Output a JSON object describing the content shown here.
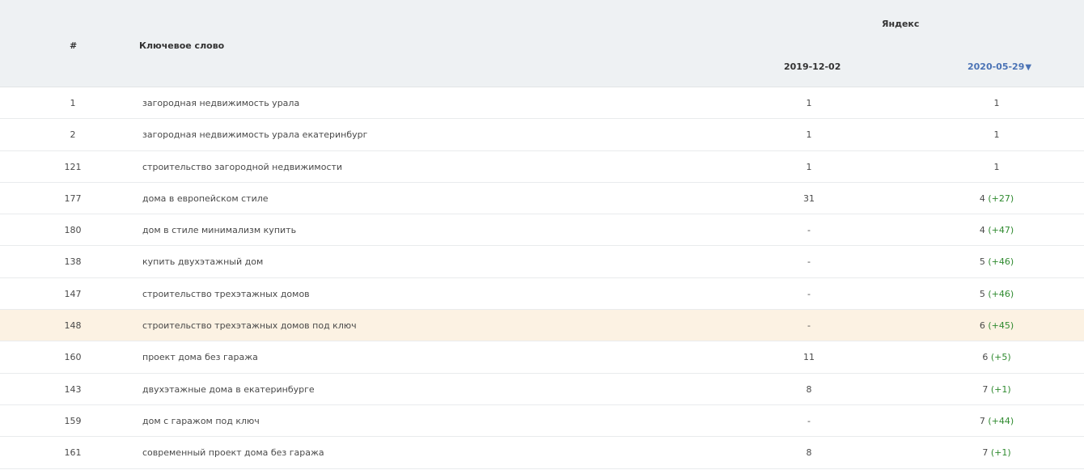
{
  "header": {
    "num": "#",
    "keyword": "Ключевое слово",
    "engine": "Яндекс",
    "date1": "2019-12-02",
    "date2": "2020-05-29",
    "sort_arrow": "▼"
  },
  "colors": {
    "header_bg": "#eef1f3",
    "highlight_bg": "#fcf2e3",
    "link": "#4b73b5",
    "positive_delta": "#2f8a2f"
  },
  "rows": [
    {
      "num": "1",
      "keyword": "загородная недвижимость урала",
      "pos1": "1",
      "pos2": "1",
      "delta": ""
    },
    {
      "num": "2",
      "keyword": "загородная недвижимость урала екатеринбург",
      "pos1": "1",
      "pos2": "1",
      "delta": ""
    },
    {
      "num": "121",
      "keyword": "строительство загородной недвижимости",
      "pos1": "1",
      "pos2": "1",
      "delta": ""
    },
    {
      "num": "177",
      "keyword": "дома в европейском стиле",
      "pos1": "31",
      "pos2": "4",
      "delta": "(+27)"
    },
    {
      "num": "180",
      "keyword": "дом в стиле минимализм купить",
      "pos1": "-",
      "pos2": "4",
      "delta": "(+47)"
    },
    {
      "num": "138",
      "keyword": "купить двухэтажный дом",
      "pos1": "-",
      "pos2": "5",
      "delta": "(+46)"
    },
    {
      "num": "147",
      "keyword": "строительство трехэтажных домов",
      "pos1": "-",
      "pos2": "5",
      "delta": "(+46)"
    },
    {
      "num": "148",
      "keyword": "строительство трехэтажных домов под ключ",
      "pos1": "-",
      "pos2": "6",
      "delta": "(+45)"
    },
    {
      "num": "160",
      "keyword": "проект дома без гаража",
      "pos1": "11",
      "pos2": "6",
      "delta": "(+5)"
    },
    {
      "num": "143",
      "keyword": "двухэтажные дома в екатеринбурге",
      "pos1": "8",
      "pos2": "7",
      "delta": "(+1)"
    },
    {
      "num": "159",
      "keyword": "дом с гаражом под ключ",
      "pos1": "-",
      "pos2": "7",
      "delta": "(+44)"
    },
    {
      "num": "161",
      "keyword": "современный проект дома без гаража",
      "pos1": "8",
      "pos2": "7",
      "delta": "(+1)"
    }
  ]
}
